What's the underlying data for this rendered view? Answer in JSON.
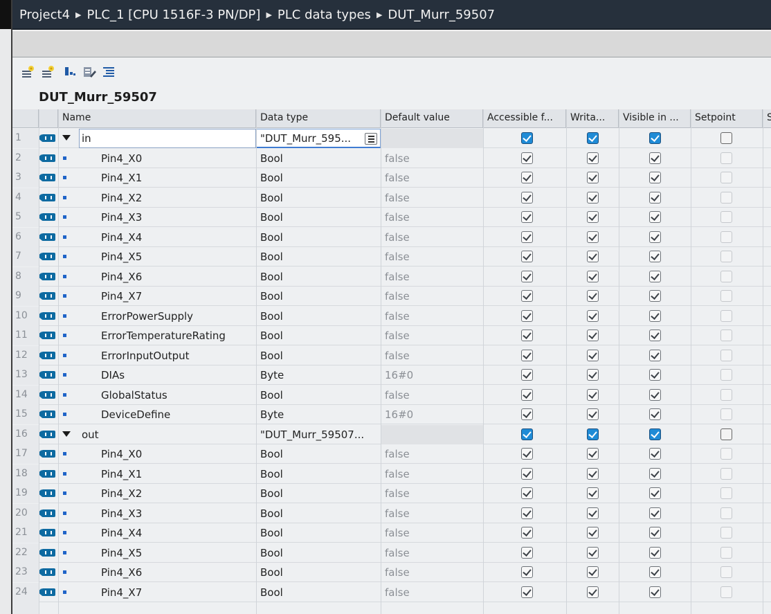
{
  "breadcrumb": [
    "Project4",
    "PLC_1 [CPU 1516F-3 PN/DP]",
    "PLC data types",
    "DUT_Murr_59507"
  ],
  "toolbar": {
    "icons": [
      "insert-row-icon",
      "add-row-icon",
      "expand-icon",
      "edit-icon",
      "list-view-icon"
    ]
  },
  "dut_name": "DUT_Murr_59507",
  "columns": {
    "name": "Name",
    "data_type": "Data type",
    "default_value": "Default value",
    "accessible": "Accessible f...",
    "writable": "Writa...",
    "visible": "Visible in ...",
    "setpoint": "Setpoint",
    "extra": "S"
  },
  "rows": [
    {
      "n": "1",
      "name": "in",
      "type": "\"DUT_Murr_595...",
      "def": "",
      "kind": "parent",
      "acc": true,
      "wr": true,
      "vis": true,
      "sp": false
    },
    {
      "n": "2",
      "name": "Pin4_X0",
      "type": "Bool",
      "def": "false",
      "kind": "child"
    },
    {
      "n": "3",
      "name": "Pin4_X1",
      "type": "Bool",
      "def": "false",
      "kind": "child"
    },
    {
      "n": "4",
      "name": "Pin4_X2",
      "type": "Bool",
      "def": "false",
      "kind": "child"
    },
    {
      "n": "5",
      "name": "Pin4_X3",
      "type": "Bool",
      "def": "false",
      "kind": "child"
    },
    {
      "n": "6",
      "name": "Pin4_X4",
      "type": "Bool",
      "def": "false",
      "kind": "child"
    },
    {
      "n": "7",
      "name": "Pin4_X5",
      "type": "Bool",
      "def": "false",
      "kind": "child"
    },
    {
      "n": "8",
      "name": "Pin4_X6",
      "type": "Bool",
      "def": "false",
      "kind": "child"
    },
    {
      "n": "9",
      "name": "Pin4_X7",
      "type": "Bool",
      "def": "false",
      "kind": "child"
    },
    {
      "n": "10",
      "name": "ErrorPowerSupply",
      "type": "Bool",
      "def": "false",
      "kind": "child"
    },
    {
      "n": "11",
      "name": "ErrorTemperatureRating",
      "type": "Bool",
      "def": "false",
      "kind": "child"
    },
    {
      "n": "12",
      "name": "ErrorInputOutput",
      "type": "Bool",
      "def": "false",
      "kind": "child"
    },
    {
      "n": "13",
      "name": "DIAs",
      "type": "Byte",
      "def": "16#0",
      "kind": "child"
    },
    {
      "n": "14",
      "name": "GlobalStatus",
      "type": "Bool",
      "def": "false",
      "kind": "child"
    },
    {
      "n": "15",
      "name": "DeviceDefine",
      "type": "Byte",
      "def": "16#0",
      "kind": "child"
    },
    {
      "n": "16",
      "name": "out",
      "type": "\"DUT_Murr_59507...",
      "def": "",
      "kind": "parent",
      "acc": true,
      "wr": true,
      "vis": true,
      "sp": false
    },
    {
      "n": "17",
      "name": "Pin4_X0",
      "type": "Bool",
      "def": "false",
      "kind": "child"
    },
    {
      "n": "18",
      "name": "Pin4_X1",
      "type": "Bool",
      "def": "false",
      "kind": "child"
    },
    {
      "n": "19",
      "name": "Pin4_X2",
      "type": "Bool",
      "def": "false",
      "kind": "child"
    },
    {
      "n": "20",
      "name": "Pin4_X3",
      "type": "Bool",
      "def": "false",
      "kind": "child"
    },
    {
      "n": "21",
      "name": "Pin4_X4",
      "type": "Bool",
      "def": "false",
      "kind": "child"
    },
    {
      "n": "22",
      "name": "Pin4_X5",
      "type": "Bool",
      "def": "false",
      "kind": "child"
    },
    {
      "n": "23",
      "name": "Pin4_X6",
      "type": "Bool",
      "def": "false",
      "kind": "child"
    },
    {
      "n": "24",
      "name": "Pin4_X7",
      "type": "Bool",
      "def": "false",
      "kind": "child"
    }
  ],
  "colors": {
    "title_bg": "#26303c",
    "accent_blue": "#1f8bd6",
    "tag_blue": "#0d6aa1"
  }
}
